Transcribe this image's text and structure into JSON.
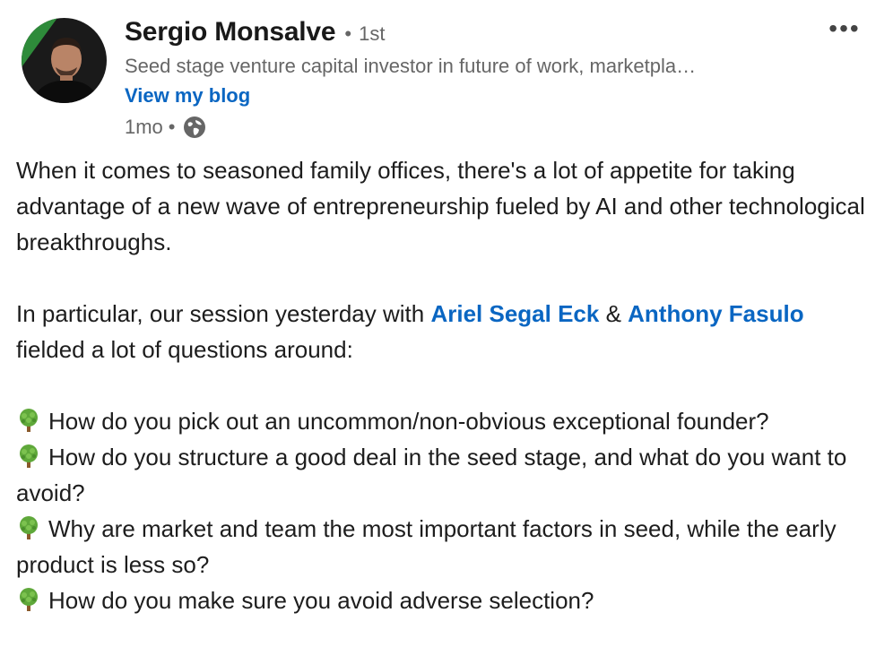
{
  "author": {
    "name": "Sergio Monsalve",
    "degree": "1st",
    "headline": "Seed stage venture capital investor in future of work, marketpla…",
    "blog_link": "View my blog",
    "age": "1mo",
    "visibility_icon": "globe-icon",
    "avatar_icon": "profile-photo"
  },
  "menu": {
    "more_icon": "more-horizontal-icon",
    "more_label": "•••"
  },
  "post": {
    "intro": "When it comes to seasoned family offices, there's a lot of appetite for taking advantage of a new wave of entrepreneurship fueled by AI and other technological breakthroughs.",
    "session_prefix": "In particular, our session yesterday with ",
    "mention1": "Ariel Segal Eck",
    "session_amp": " & ",
    "mention2": "Anthony Fasulo",
    "session_suffix": " fielded a lot of questions around:",
    "bullet_icon": "tree-emoji",
    "bullets": [
      "How do you pick out an uncommon/non-obvious exceptional founder?",
      "How do you structure a good deal in the seed stage, and what do you want to avoid?",
      "Why are market and team the most important factors in seed, while the early product is less so?",
      "How do you make sure you avoid adverse selection?"
    ]
  },
  "colors": {
    "link": "#0a66c2",
    "text": "#1d1d1d",
    "muted": "#666666"
  }
}
